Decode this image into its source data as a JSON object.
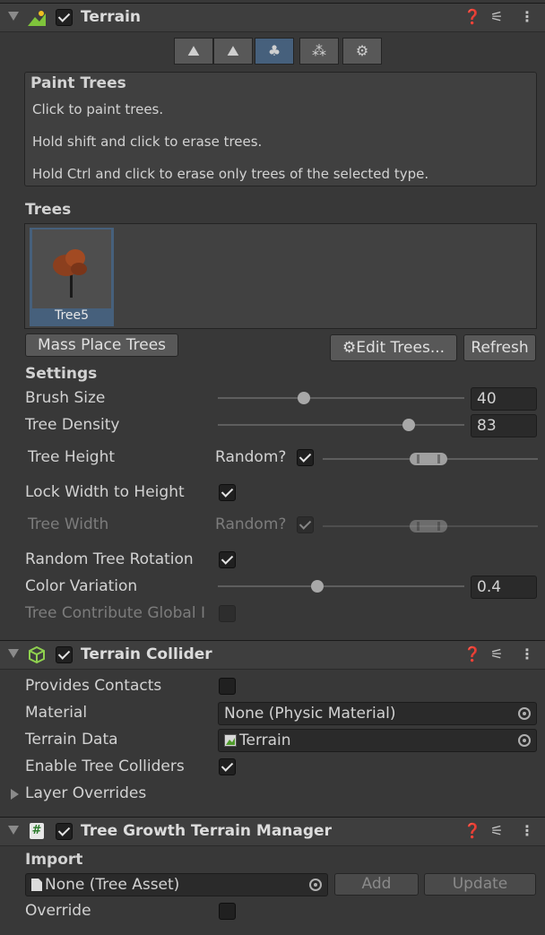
{
  "terrain": {
    "title": "Terrain",
    "enabled": true,
    "tools": [
      {
        "icon": "raise-terrain-icon",
        "glyph": "⛰",
        "active": false
      },
      {
        "icon": "paint-terrain-icon",
        "glyph": "⛰",
        "active": false
      },
      {
        "icon": "paint-trees-icon",
        "glyph": "♣",
        "active": true
      },
      {
        "icon": "paint-details-icon",
        "glyph": "⁂",
        "active": false
      },
      {
        "icon": "terrain-settings-icon",
        "glyph": "⚙",
        "active": false
      }
    ],
    "help": {
      "title": "Paint Trees",
      "line1": "Click to paint trees.",
      "line2": "Hold shift and click to erase trees.",
      "line3": "Hold Ctrl and click to erase only trees of the selected type."
    },
    "trees_label": "Trees",
    "tree_item": "Tree5",
    "mass_place": "Mass Place Trees",
    "edit_trees": "Edit Trees...",
    "refresh": "Refresh",
    "settings_label": "Settings",
    "brush_size": {
      "label": "Brush Size",
      "value": "40",
      "fraction": 0.34
    },
    "tree_density": {
      "label": "Tree Density",
      "value": "83",
      "fraction": 0.79
    },
    "tree_height": {
      "label": "Tree Height",
      "random_label": "Random?",
      "random": true
    },
    "lock_width": {
      "label": "Lock Width to Height",
      "checked": true
    },
    "tree_width": {
      "label": "Tree Width",
      "random_label": "Random?",
      "random": true
    },
    "random_rotation": {
      "label": "Random Tree Rotation",
      "checked": true
    },
    "color_variation": {
      "label": "Color Variation",
      "value": "0.4",
      "fraction": 0.4
    },
    "tree_contribute": {
      "label": "Tree Contribute Global I",
      "checked": false
    }
  },
  "collider": {
    "title": "Terrain Collider",
    "enabled": true,
    "provides_contacts": {
      "label": "Provides Contacts",
      "checked": false
    },
    "material": {
      "label": "Material",
      "value": "None (Physic Material)"
    },
    "terrain_data": {
      "label": "Terrain Data",
      "value": "Terrain"
    },
    "enable_tree_colliders": {
      "label": "Enable Tree Colliders",
      "checked": true
    },
    "layer_overrides": "Layer Overrides"
  },
  "manager": {
    "title": "Tree Growth Terrain Manager",
    "enabled": true,
    "import_label": "Import",
    "asset_value": "None (Tree Asset)",
    "add": "Add",
    "update": "Update",
    "override": {
      "label": "Override",
      "checked": false
    }
  },
  "colors": {
    "panel": "#383838",
    "header": "#3e3e3e",
    "selection": "#46607c",
    "field": "#2a2a2a"
  }
}
